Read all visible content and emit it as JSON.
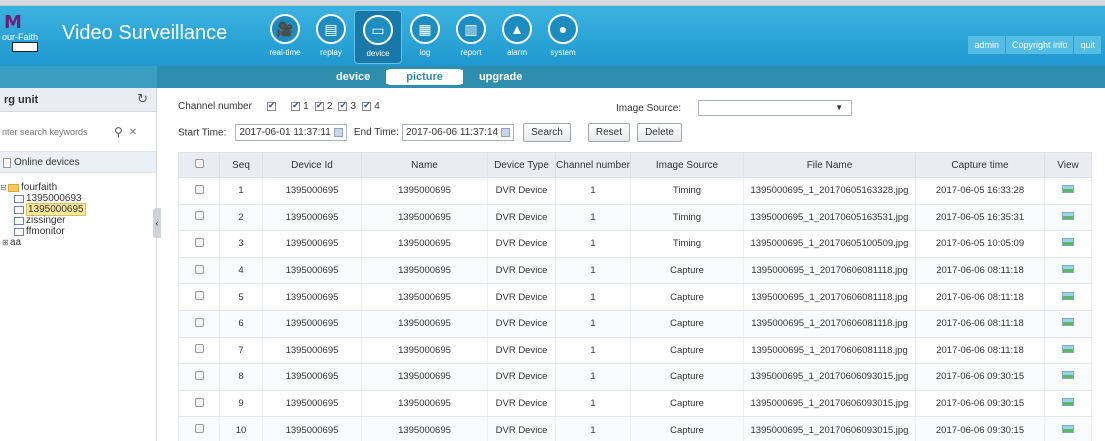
{
  "app": {
    "title": "Video Surveillance",
    "logo_text": "our-Faith"
  },
  "nav": [
    {
      "label": "real-time",
      "icon": "camera-icon",
      "glyph": "🎥"
    },
    {
      "label": "replay",
      "icon": "film-icon",
      "glyph": "▤"
    },
    {
      "label": "device",
      "icon": "device-icon",
      "glyph": "▭"
    },
    {
      "label": "log",
      "icon": "log-icon",
      "glyph": "▦"
    },
    {
      "label": "report",
      "icon": "report-icon",
      "glyph": "▥"
    },
    {
      "label": "alarm",
      "icon": "alarm-icon",
      "glyph": "▲"
    },
    {
      "label": "system",
      "icon": "user-icon",
      "glyph": "●"
    }
  ],
  "nav_active": "device",
  "top_buttons": {
    "admin": "admin",
    "copyright": "Copyright info",
    "quit": "quit"
  },
  "subtabs": {
    "device": "device",
    "picture": "picture",
    "upgrade": "upgrade"
  },
  "sidebar": {
    "title": "rg unit",
    "search_placeholder": "nter search keywords",
    "online_label": "Online devices",
    "tree": {
      "root": "fourfaith",
      "children": [
        "1395000693",
        "1395000695",
        "zissinger",
        "ffmonitor"
      ],
      "other": "aa"
    }
  },
  "filter": {
    "channel_label": "Channel number",
    "channels": [
      "1",
      "2",
      "3",
      "4"
    ],
    "image_source_label": "Image Source:",
    "start_label": "Start Time:",
    "start_value": "2017-06-01 11:37:11",
    "end_label": "End Time:",
    "end_value": "2017-06-06 11:37:14",
    "search": "Search",
    "reset": "Reset",
    "delete": "Delete"
  },
  "table": {
    "headers": [
      "Seq",
      "Device Id",
      "Name",
      "Device Type",
      "Channel number",
      "Image Source",
      "File Name",
      "Capture time",
      "View"
    ],
    "rows": [
      {
        "seq": "1",
        "device_id": "1395000695",
        "name": "1395000695",
        "type": "DVR Device",
        "channel": "1",
        "source": "Timing",
        "file": "1395000695_1_20170605163328.jpg",
        "time": "2017-06-05 16:33:28"
      },
      {
        "seq": "2",
        "device_id": "1395000695",
        "name": "1395000695",
        "type": "DVR Device",
        "channel": "1",
        "source": "Timing",
        "file": "1395000695_1_20170605163531.jpg",
        "time": "2017-06-05 16:35:31"
      },
      {
        "seq": "3",
        "device_id": "1395000695",
        "name": "1395000695",
        "type": "DVR Device",
        "channel": "1",
        "source": "Timing",
        "file": "1395000695_1_20170605100509.jpg",
        "time": "2017-06-05 10:05:09"
      },
      {
        "seq": "4",
        "device_id": "1395000695",
        "name": "1395000695",
        "type": "DVR Device",
        "channel": "1",
        "source": "Capture",
        "file": "1395000695_1_20170606081118.jpg",
        "time": "2017-06-06 08:11:18"
      },
      {
        "seq": "5",
        "device_id": "1395000695",
        "name": "1395000695",
        "type": "DVR Device",
        "channel": "1",
        "source": "Capture",
        "file": "1395000695_1_20170606081118.jpg",
        "time": "2017-06-06 08:11:18"
      },
      {
        "seq": "6",
        "device_id": "1395000695",
        "name": "1395000695",
        "type": "DVR Device",
        "channel": "1",
        "source": "Capture",
        "file": "1395000695_1_20170606081118.jpg",
        "time": "2017-06-06 08:11:18"
      },
      {
        "seq": "7",
        "device_id": "1395000695",
        "name": "1395000695",
        "type": "DVR Device",
        "channel": "1",
        "source": "Capture",
        "file": "1395000695_1_20170606081118.jpg",
        "time": "2017-06-06 08:11:18"
      },
      {
        "seq": "8",
        "device_id": "1395000695",
        "name": "1395000695",
        "type": "DVR Device",
        "channel": "1",
        "source": "Capture",
        "file": "1395000695_1_20170606093015.jpg",
        "time": "2017-06-06 09:30:15"
      },
      {
        "seq": "9",
        "device_id": "1395000695",
        "name": "1395000695",
        "type": "DVR Device",
        "channel": "1",
        "source": "Capture",
        "file": "1395000695_1_20170606093015.jpg",
        "time": "2017-06-06 09:30:15"
      },
      {
        "seq": "10",
        "device_id": "1395000695",
        "name": "1395000695",
        "type": "DVR Device",
        "channel": "1",
        "source": "Capture",
        "file": "1395000695_1_20170606093015.jpg",
        "time": "2017-06-06 09:30:15"
      }
    ]
  },
  "colors": {
    "header": "#1f98cf",
    "subbar": "#2e8eae",
    "selected_node": "#f9e79a"
  }
}
